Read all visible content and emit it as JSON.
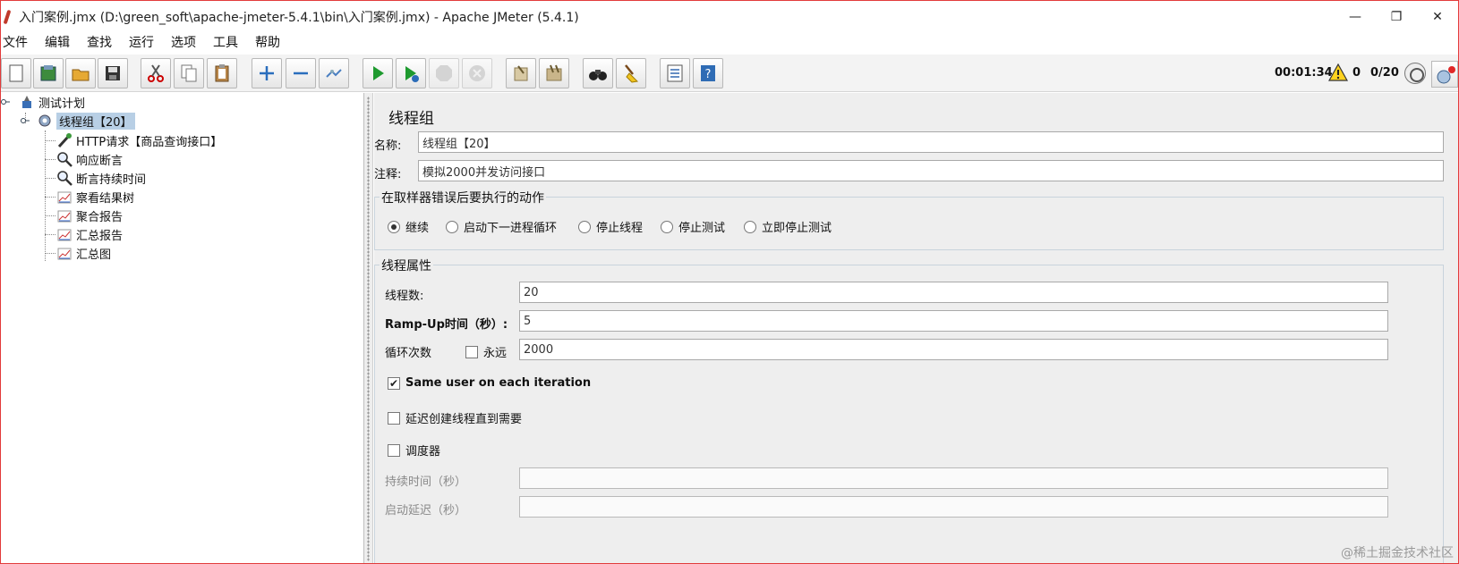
{
  "window": {
    "title": "入门案例.jmx (D:\\green_soft\\apache-jmeter-5.4.1\\bin\\入门案例.jmx) - Apache JMeter (5.4.1)",
    "minimize": "—",
    "restore": "❐",
    "close": "✕"
  },
  "menu": [
    "文件",
    "编辑",
    "查找",
    "运行",
    "选项",
    "工具",
    "帮助"
  ],
  "toolbar": {
    "icons": [
      "new-icon",
      "templates-icon",
      "open-icon",
      "save-icon",
      "cut-icon",
      "copy-icon",
      "paste-icon",
      "expand-icon",
      "collapse-icon",
      "toggle-icon",
      "start-icon",
      "start-no-pause-icon",
      "stop-icon",
      "shutdown-icon",
      "clear-icon",
      "clear-all-icon",
      "search-icon",
      "reset-search-icon",
      "function-helper-icon",
      "help-icon"
    ],
    "elapsed": "00:01:34",
    "warnings": "0",
    "threads": "0/20"
  },
  "tree": {
    "items": [
      {
        "label": "测试计划",
        "icon": "test-plan-icon"
      },
      {
        "label": "线程组【20】",
        "icon": "thread-group-icon"
      },
      {
        "label": "HTTP请求【商品查询接口】",
        "icon": "http-sampler-icon"
      },
      {
        "label": "响应断言",
        "icon": "assertion-icon"
      },
      {
        "label": "断言持续时间",
        "icon": "assertion-icon"
      },
      {
        "label": "察看结果树",
        "icon": "listener-icon"
      },
      {
        "label": "聚合报告",
        "icon": "listener-icon"
      },
      {
        "label": "汇总报告",
        "icon": "listener-icon"
      },
      {
        "label": "汇总图",
        "icon": "listener-icon"
      }
    ]
  },
  "panel": {
    "title": "线程组",
    "name_label": "名称:",
    "name_value": "线程组【20】",
    "comment_label": "注释:",
    "comment_value": "模拟2000并发访问接口",
    "error_group": {
      "title": "在取样器错误后要执行的动作",
      "options": [
        "继续",
        "启动下一进程循环",
        "停止线程",
        "停止测试",
        "立即停止测试"
      ],
      "selected": 0
    },
    "thread_group": {
      "title": "线程属性",
      "threads_label": "线程数:",
      "threads_value": "20",
      "rampup_label": "Ramp-Up时间（秒）:",
      "rampup_value": "5",
      "loop_label": "循环次数",
      "forever_label": "永远",
      "loop_value": "2000",
      "same_user_label": "Same user on each iteration",
      "delay_label": "延迟创建线程直到需要",
      "scheduler_label": "调度器",
      "duration_label": "持续时间（秒）",
      "duration_value": "",
      "startup_delay_label": "启动延迟（秒）",
      "startup_delay_value": ""
    }
  },
  "watermark": "@稀土掘金技术社区"
}
